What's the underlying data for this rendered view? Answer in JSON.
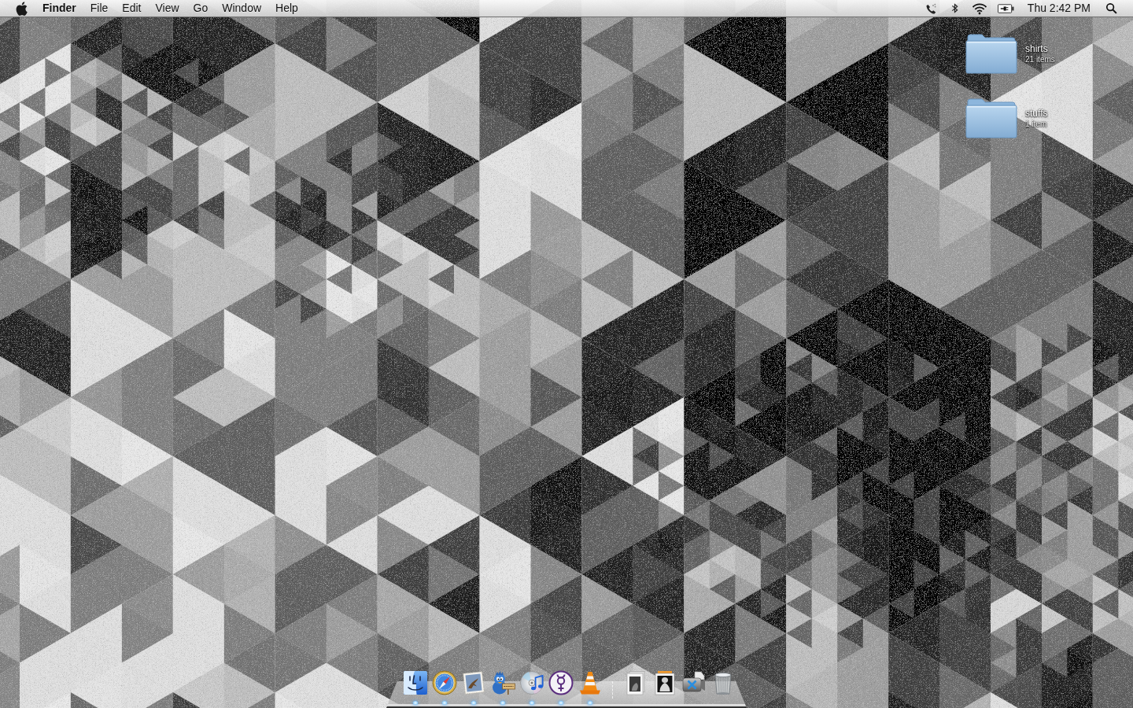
{
  "menu_bar": {
    "app_name": "Finder",
    "menus": [
      "File",
      "Edit",
      "View",
      "Go",
      "Window",
      "Help"
    ],
    "clock": "Thu 2:42 PM"
  },
  "desktop_icons": [
    {
      "name": "shirts",
      "info": "21 items"
    },
    {
      "name": "stuffs",
      "info": "1 item"
    }
  ],
  "dock": {
    "apps": [
      {
        "kind": "finder",
        "running": true
      },
      {
        "kind": "compass",
        "running": true
      },
      {
        "kind": "stamp",
        "running": true
      },
      {
        "kind": "bird",
        "running": true
      },
      {
        "kind": "disc",
        "running": true
      },
      {
        "kind": "symbol",
        "running": true
      },
      {
        "kind": "cone",
        "running": true
      }
    ],
    "documents": [
      {
        "kind": "stack"
      },
      {
        "kind": "album"
      },
      {
        "kind": "camera"
      },
      {
        "kind": "trash"
      }
    ]
  }
}
